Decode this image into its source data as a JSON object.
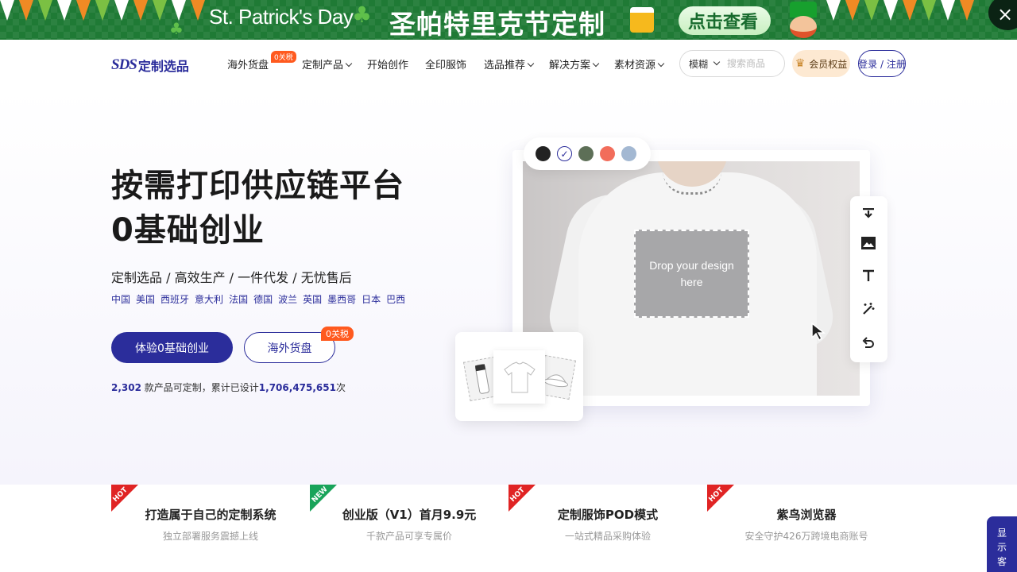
{
  "banner": {
    "title_en": "St. Patrick's Day",
    "title_cn": "圣帕特里克节定制",
    "cta": "点击查看",
    "close_icon": "×"
  },
  "nav": {
    "logo_mark": "SDS",
    "logo_text": "定制选品",
    "items": [
      {
        "label": "海外货盘",
        "has_caret": false,
        "badge": "0关税"
      },
      {
        "label": "定制产品",
        "has_caret": true
      },
      {
        "label": "开始创作",
        "has_caret": false
      },
      {
        "label": "全印服饰",
        "has_caret": false
      },
      {
        "label": "选品推荐",
        "has_caret": true
      },
      {
        "label": "解决方案",
        "has_caret": true
      },
      {
        "label": "素材资源",
        "has_caret": true
      }
    ],
    "search": {
      "mode": "模糊",
      "placeholder": "搜索商品"
    },
    "vip_label": "会员权益",
    "login_label": "登录 / 注册"
  },
  "hero": {
    "headline_line1": "按需打印供应链平台",
    "headline_line2": "0基础创业",
    "subline": "定制选品 / 高效生产 / 一件代发 / 无忧售后",
    "countries": [
      "中国",
      "美国",
      "西班牙",
      "意大利",
      "法国",
      "德国",
      "波兰",
      "英国",
      "墨西哥",
      "日本",
      "巴西"
    ],
    "primary_button": "体验0基础创业",
    "secondary_button": "海外货盘",
    "secondary_badge": "0关税",
    "stats": {
      "products_count": "2,302",
      "products_text": " 款产品可定制，累计已设计",
      "designs_count": "1,706,475,651",
      "designs_suffix": "次"
    },
    "mockup": {
      "drop_text_line1": "Drop your design",
      "drop_text_line2": "here",
      "swatch_colors": [
        "#222222",
        "#ffffff",
        "#5d6f57",
        "#f26d5b",
        "#a3b8d2"
      ],
      "selected_swatch": 1,
      "tools": [
        "download-icon",
        "image-icon",
        "text-icon",
        "magic-wand-icon",
        "undo-icon"
      ]
    }
  },
  "features": [
    {
      "tag": "HOT",
      "title": "打造属于自己的定制系统",
      "subtitle": "独立部署服务震撼上线"
    },
    {
      "tag": "NEW",
      "title": "创业版（V1）首月9.9元",
      "subtitle": "千款产品可享专属价"
    },
    {
      "tag": "HOT",
      "title": "定制服饰POD模式",
      "subtitle": "一站式精品采购体验"
    },
    {
      "tag": "HOT",
      "title": "紫鸟浏览器",
      "subtitle": "安全守护426万跨境电商账号"
    }
  ],
  "side_float": {
    "label_line1": "显",
    "label_line2": "示",
    "label_line3": "客"
  }
}
